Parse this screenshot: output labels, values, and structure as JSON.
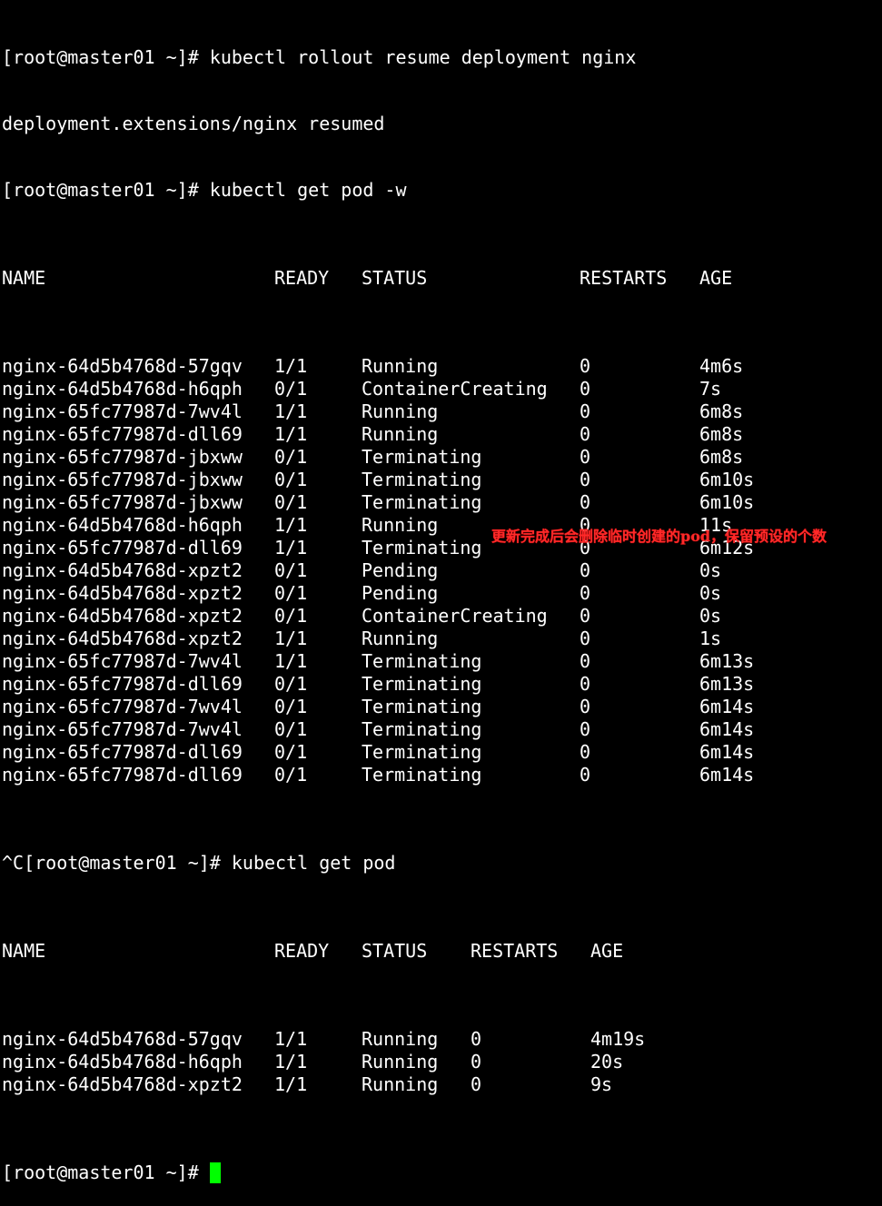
{
  "terminal": {
    "cmd1": "[root@master01 ~]# kubectl rollout resume deployment nginx",
    "out1": "deployment.extensions/nginx resumed",
    "cmd2": "[root@master01 ~]# kubectl get pod -w",
    "watch_headers": [
      "NAME",
      "READY",
      "STATUS",
      "RESTARTS",
      "AGE"
    ],
    "watch_rows": [
      [
        "nginx-64d5b4768d-57gqv",
        "1/1",
        "Running",
        "0",
        "4m6s"
      ],
      [
        "nginx-64d5b4768d-h6qph",
        "0/1",
        "ContainerCreating",
        "0",
        "7s"
      ],
      [
        "nginx-65fc77987d-7wv4l",
        "1/1",
        "Running",
        "0",
        "6m8s"
      ],
      [
        "nginx-65fc77987d-dll69",
        "1/1",
        "Running",
        "0",
        "6m8s"
      ],
      [
        "nginx-65fc77987d-jbxww",
        "0/1",
        "Terminating",
        "0",
        "6m8s"
      ],
      [
        "nginx-65fc77987d-jbxww",
        "0/1",
        "Terminating",
        "0",
        "6m10s"
      ],
      [
        "nginx-65fc77987d-jbxww",
        "0/1",
        "Terminating",
        "0",
        "6m10s"
      ],
      [
        "nginx-64d5b4768d-h6qph",
        "1/1",
        "Running",
        "0",
        "11s"
      ],
      [
        "nginx-65fc77987d-dll69",
        "1/1",
        "Terminating",
        "0",
        "6m12s"
      ],
      [
        "nginx-64d5b4768d-xpzt2",
        "0/1",
        "Pending",
        "0",
        "0s"
      ],
      [
        "nginx-64d5b4768d-xpzt2",
        "0/1",
        "Pending",
        "0",
        "0s"
      ],
      [
        "nginx-64d5b4768d-xpzt2",
        "0/1",
        "ContainerCreating",
        "0",
        "0s"
      ],
      [
        "nginx-64d5b4768d-xpzt2",
        "1/1",
        "Running",
        "0",
        "1s"
      ],
      [
        "nginx-65fc77987d-7wv4l",
        "1/1",
        "Terminating",
        "0",
        "6m13s"
      ],
      [
        "nginx-65fc77987d-dll69",
        "0/1",
        "Terminating",
        "0",
        "6m13s"
      ],
      [
        "nginx-65fc77987d-7wv4l",
        "0/1",
        "Terminating",
        "0",
        "6m14s"
      ],
      [
        "nginx-65fc77987d-7wv4l",
        "0/1",
        "Terminating",
        "0",
        "6m14s"
      ],
      [
        "nginx-65fc77987d-dll69",
        "0/1",
        "Terminating",
        "0",
        "6m14s"
      ],
      [
        "nginx-65fc77987d-dll69",
        "0/1",
        "Terminating",
        "0",
        "6m14s"
      ]
    ],
    "cmd3": "^C[root@master01 ~]# kubectl get pod",
    "get_headers": [
      "NAME",
      "READY",
      "STATUS",
      "RESTARTS",
      "AGE"
    ],
    "get_rows": [
      [
        "nginx-64d5b4768d-57gqv",
        "1/1",
        "Running",
        "0",
        "4m19s"
      ],
      [
        "nginx-64d5b4768d-h6qph",
        "1/1",
        "Running",
        "0",
        "20s"
      ],
      [
        "nginx-64d5b4768d-xpzt2",
        "1/1",
        "Running",
        "0",
        "9s"
      ]
    ],
    "prompt": "[root@master01 ~]# ",
    "cursor_color": "#00ff00"
  },
  "annotation": {
    "text": "更新完成后会删除临时创建的pod，保留预设的个数",
    "color": "#ff2a2a"
  }
}
